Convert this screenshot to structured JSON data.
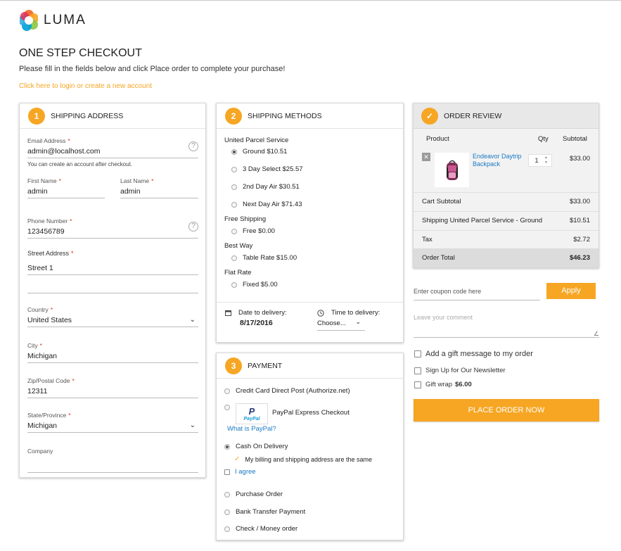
{
  "brand": {
    "name": "LUMA"
  },
  "page": {
    "title": "ONE STEP CHECKOUT",
    "subtitle": "Please fill in the fields below and click Place order to complete your purchase!",
    "login_link": "Click here to login or create a new account"
  },
  "shipping_address": {
    "step": "1",
    "title": "SHIPPING ADDRESS",
    "email": {
      "label": "Email Address",
      "value": "admin@localhost.com",
      "note": "You can create an account after checkout."
    },
    "first_name": {
      "label": "First Name",
      "value": "admin"
    },
    "last_name": {
      "label": "Last Name",
      "value": "admin"
    },
    "phone": {
      "label": "Phone Number",
      "value": "123456789"
    },
    "street": {
      "label": "Street Address",
      "line1": "Street 1",
      "line2": ""
    },
    "country": {
      "label": "Country",
      "value": "United States"
    },
    "city": {
      "label": "City",
      "value": "Michigan"
    },
    "zip": {
      "label": "Zip/Postal Code",
      "value": "12311"
    },
    "state": {
      "label": "State/Province",
      "value": "Michigan"
    },
    "company": {
      "label": "Company",
      "value": ""
    }
  },
  "shipping_methods": {
    "step": "2",
    "title": "SHIPPING METHODS",
    "groups": [
      {
        "name": "United Parcel Service",
        "options": [
          {
            "label": "Ground $10.51",
            "selected": true
          },
          {
            "label": "3 Day Select $25.57",
            "selected": false
          },
          {
            "label": "2nd Day Air $30.51",
            "selected": false
          },
          {
            "label": "Next Day Air $71.43",
            "selected": false
          }
        ]
      },
      {
        "name": "Free Shipping",
        "options": [
          {
            "label": "Free $0.00",
            "selected": false
          }
        ]
      },
      {
        "name": "Best Way",
        "options": [
          {
            "label": "Table Rate $15.00",
            "selected": false
          }
        ]
      },
      {
        "name": "Flat Rate",
        "options": [
          {
            "label": "Fixed $5.00",
            "selected": false
          }
        ]
      }
    ],
    "date_label": "Date to delivery:",
    "date_value": "8/17/2016",
    "time_label": "Time to delivery:",
    "time_value": "Choose..."
  },
  "payment": {
    "step": "3",
    "title": "PAYMENT",
    "options": [
      "Credit Card Direct Post (Authorize.net)",
      "PayPal Express Checkout",
      "Cash On Delivery",
      "Purchase Order",
      "Bank Transfer Payment",
      "Check / Money order"
    ],
    "paypal_logo": "PayPal",
    "paypal_link": "What is PayPal?",
    "billing_same": "My billing and shipping address are the same",
    "agree": "I agree"
  },
  "order_review": {
    "title": "ORDER REVIEW",
    "columns": {
      "product": "Product",
      "qty": "Qty",
      "subtotal": "Subtotal"
    },
    "item": {
      "name": "Endeavor Daytrip Backpack",
      "qty": "1",
      "subtotal": "$33.00"
    },
    "totals": [
      {
        "label": "Cart Subtotal",
        "value": "$33.00"
      },
      {
        "label": "Shipping United Parcel Service - Ground",
        "value": "$10.51"
      },
      {
        "label": "Tax",
        "value": "$2.72"
      }
    ],
    "order_total": {
      "label": "Order Total",
      "value": "$46.23"
    }
  },
  "coupon": {
    "placeholder": "Enter coupon code here",
    "apply": "Apply"
  },
  "comment": {
    "placeholder": "Leave your comment"
  },
  "extras": {
    "gift_message": "Add a gift message to my order",
    "newsletter": "Sign Up for Our Newsletter",
    "gift_wrap": "Gift wrap",
    "gift_wrap_price": "$6.00"
  },
  "place_order": "PLACE ORDER NOW",
  "colors": {
    "accent": "#f6a623",
    "link_blue": "#1979c3",
    "required": "#e02b27"
  }
}
